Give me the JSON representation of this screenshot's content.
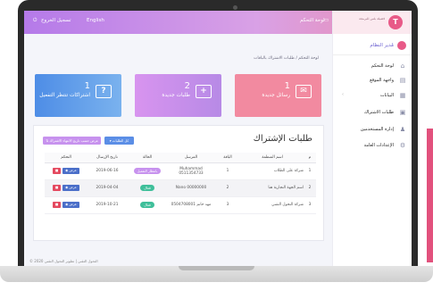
{
  "topbar": {
    "logout": "تسجيل الخروج",
    "language": "English",
    "dashboard": "لوحة التحكم"
  },
  "sidebar": {
    "logo_text": "فضيلة بلس للبرمجة",
    "user_name": "مُدير النظام",
    "items": [
      {
        "label": "لوحة التحكم",
        "icon": "home-icon"
      },
      {
        "label": "واجهة الموقع",
        "icon": "layout-icon"
      },
      {
        "label": "البيانات",
        "icon": "database-icon"
      },
      {
        "label": "طلبات الاشتراك",
        "icon": "requests-icon"
      },
      {
        "label": "إدارة المستخدمين",
        "icon": "users-icon"
      },
      {
        "label": "الإعدادات العامة",
        "icon": "settings-icon"
      }
    ]
  },
  "breadcrumb": "لوحة التحكم / طلبات الاشتراك بالباقات",
  "cards": [
    {
      "number": "1",
      "label": "رسائل جديدة",
      "icon": "mail-icon",
      "color": "#f28aa0"
    },
    {
      "number": "2",
      "label": "طلبات جديدة",
      "icon": "plus-icon",
      "color": "#c792ee"
    },
    {
      "number": "1",
      "label": "اشتراكات تنتظر التفعيل",
      "icon": "question-icon",
      "color": "#5b9be8"
    }
  ],
  "panel": {
    "title": "طلبات الإشتراك",
    "btn_all": "كل الطلبات",
    "btn_sort": "عرض حسب تاريخ الانتهاء الاشتراك"
  },
  "table": {
    "headers": [
      "م",
      "اسم المنظمة",
      "الباقة",
      "المرسل",
      "الحالة",
      "تاريخ الإرسال",
      "التحكم"
    ],
    "rows": [
      {
        "no": "1",
        "org": "شركة على الطلاب",
        "pkg": "1",
        "sender": "Muhammad 0511354733",
        "status": "بانتظار التفعيل",
        "status_color": "#c792ee",
        "date": "2019-06-16"
      },
      {
        "no": "2",
        "org": "اسم الجهة التجارية هنا",
        "pkg": "2",
        "sender": "Nano 00000000",
        "status": "فعال",
        "status_color": "#3fbf9a",
        "date": "2019-04-04"
      },
      {
        "no": "3",
        "org": "شركة التحول التقني",
        "pkg": "3",
        "sender": "مهد حاتم 0504708001",
        "status": "فعال",
        "status_color": "#3fbf9a",
        "date": "2019-10-21"
      }
    ],
    "view_label": "عرض"
  },
  "footer": "© 2020 التحول التقني | تطوير التحول التقني"
}
